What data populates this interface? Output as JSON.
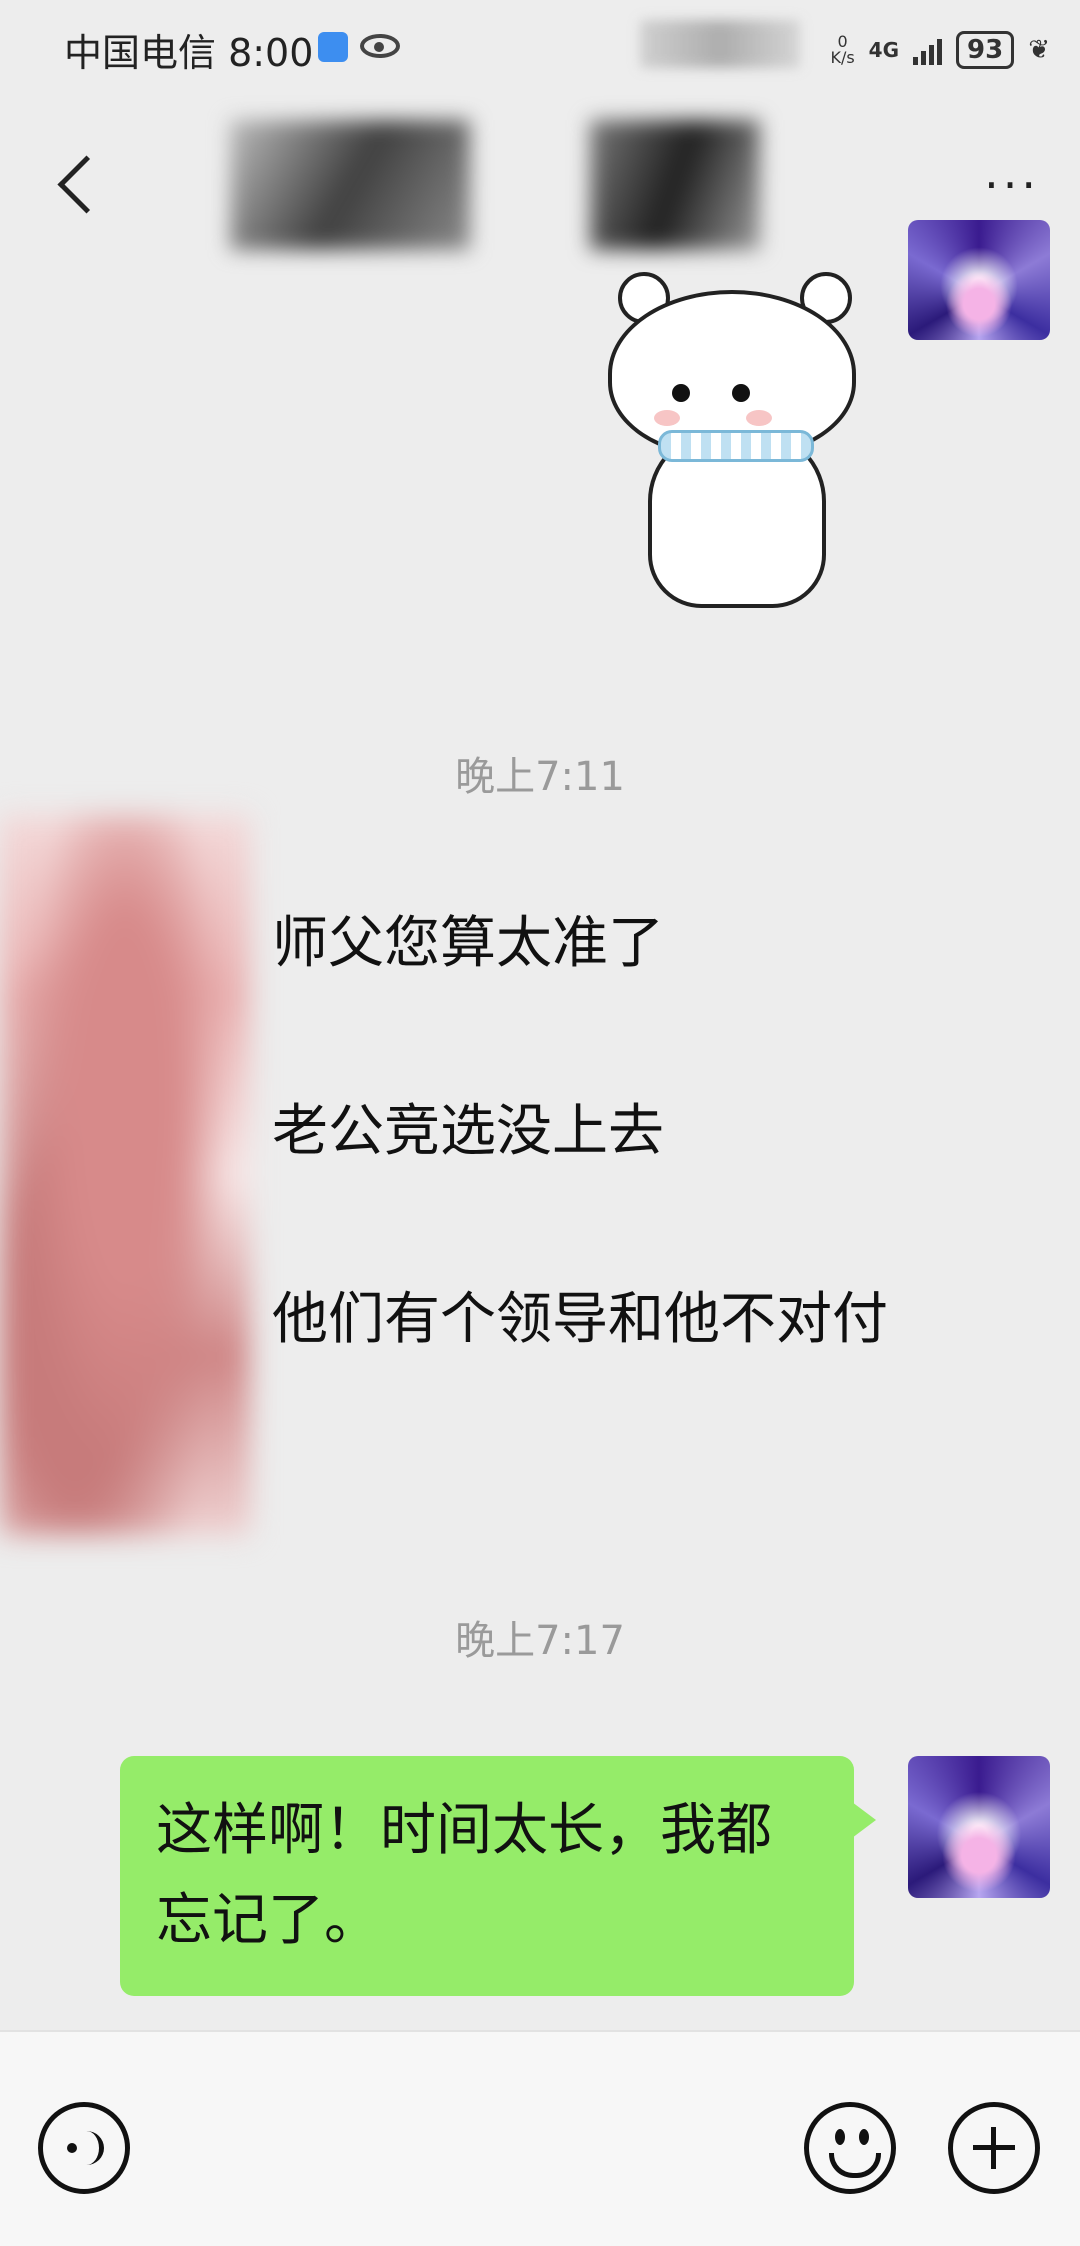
{
  "status_bar": {
    "carrier_time": "中国电信 8:00",
    "speed_value": "0",
    "speed_unit": "K/s",
    "network": "4G",
    "battery": "93"
  },
  "nav": {
    "back_icon": "back-chevron-icon",
    "more_label": "···"
  },
  "messages": {
    "timestamp_1": "晚上7:11",
    "incoming_lines": [
      "师父您算太准了",
      "老公竞选没上去",
      "他们有个领导和他不对付"
    ],
    "timestamp_2": "晚上7:17",
    "outgoing_text": "这样啊！时间太长，我都忘记了。"
  },
  "input_bar": {
    "voice_icon": "voice-icon",
    "emoji_icon": "emoji-icon",
    "plus_icon": "plus-icon"
  },
  "colors": {
    "background": "#ededed",
    "outgoing_bubble": "#95ec69",
    "timestamp_text": "#9a9a9a"
  }
}
